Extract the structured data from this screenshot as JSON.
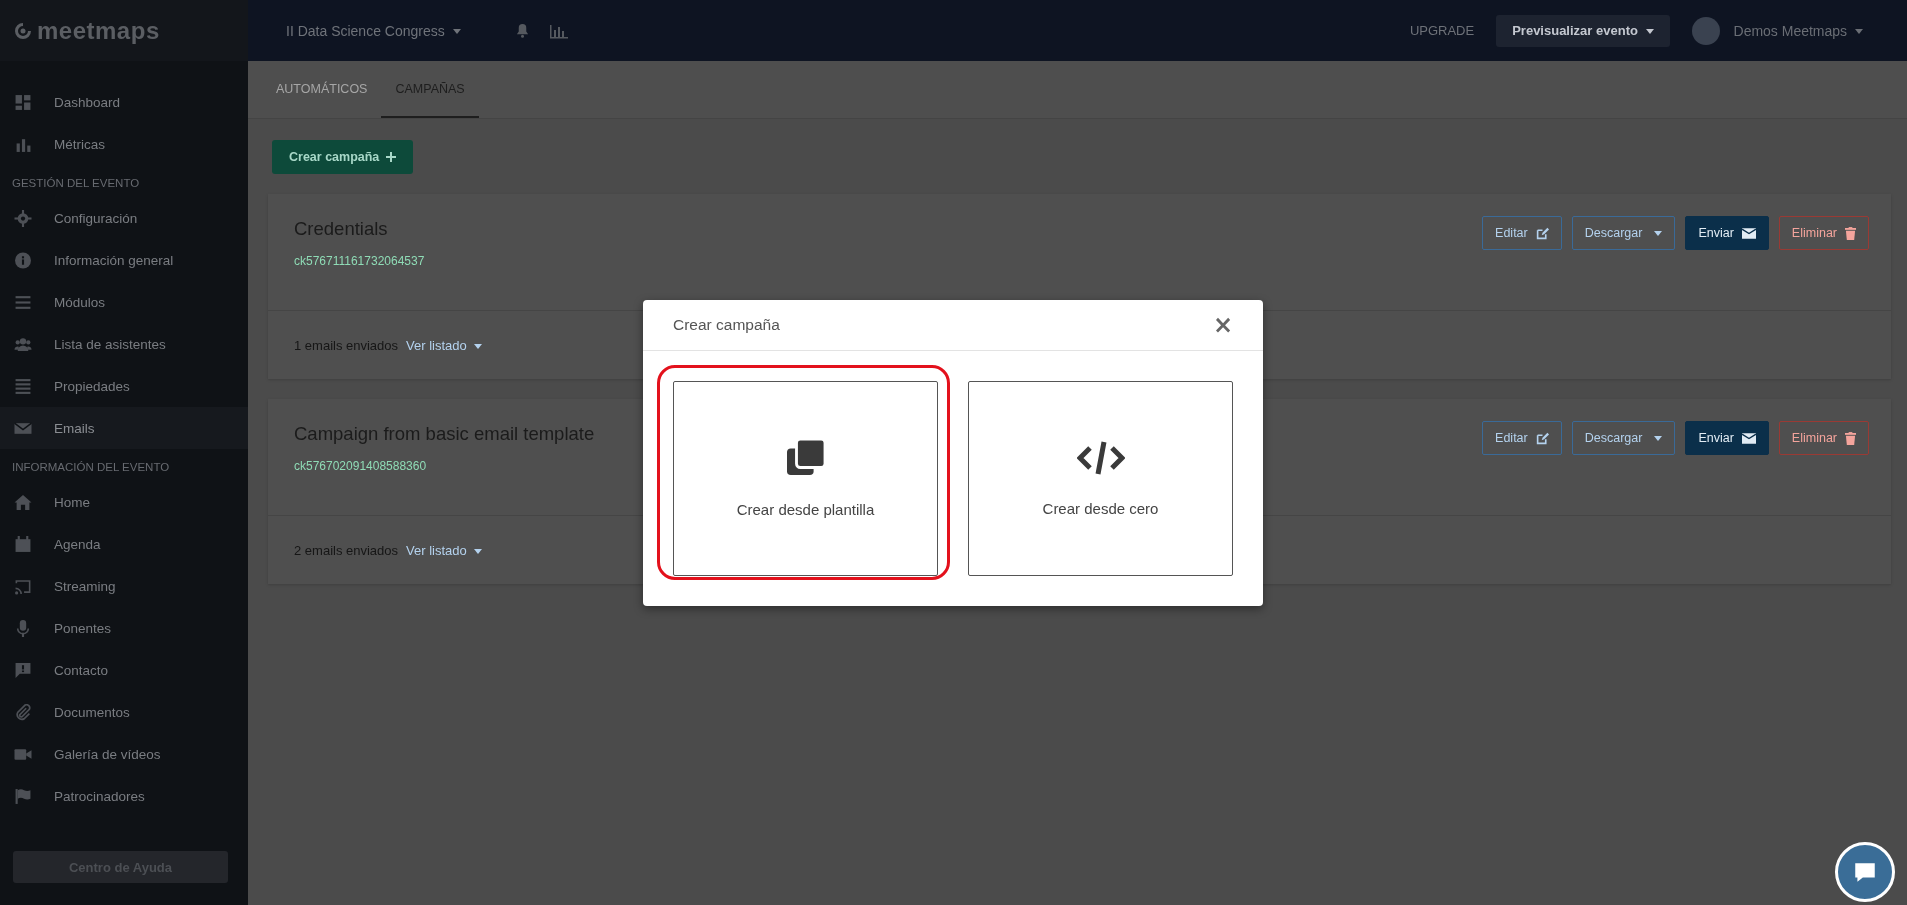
{
  "sidebar": {
    "logo": "meetmaps",
    "nav": [
      {
        "kind": "item",
        "label": "Dashboard",
        "selected": false
      },
      {
        "kind": "item",
        "label": "Métricas",
        "selected": false
      },
      {
        "kind": "section",
        "label": "GESTIÓN DEL EVENTO"
      },
      {
        "kind": "item",
        "label": "Configuración",
        "selected": false
      },
      {
        "kind": "item",
        "label": "Información general",
        "selected": false
      },
      {
        "kind": "item",
        "label": "Módulos",
        "selected": false
      },
      {
        "kind": "item",
        "label": "Lista de asistentes",
        "selected": false
      },
      {
        "kind": "item",
        "label": "Propiedades",
        "selected": false
      },
      {
        "kind": "item",
        "label": "Emails",
        "selected": true
      },
      {
        "kind": "section",
        "label": "INFORMACIÓN DEL EVENTO"
      },
      {
        "kind": "item",
        "label": "Home",
        "selected": false
      },
      {
        "kind": "item",
        "label": "Agenda",
        "selected": false
      },
      {
        "kind": "item",
        "label": "Streaming",
        "selected": false
      },
      {
        "kind": "item",
        "label": "Ponentes",
        "selected": false
      },
      {
        "kind": "item",
        "label": "Contacto",
        "selected": false
      },
      {
        "kind": "item",
        "label": "Documentos",
        "selected": false
      },
      {
        "kind": "item",
        "label": "Galería de vídeos",
        "selected": false
      },
      {
        "kind": "item",
        "label": "Patrocinadores",
        "selected": false
      }
    ],
    "help_button": "Centro de Ayuda"
  },
  "topbar": {
    "event": "II Data Science Congress",
    "upgrade": "UPGRADE",
    "preview": "Previsualizar evento",
    "user": "Demos Meetmaps"
  },
  "tabs": [
    {
      "label": "AUTOMÁTICOS",
      "selected": false
    },
    {
      "label": "CAMPAÑAS",
      "selected": true
    }
  ],
  "create_button": "Crear campaña",
  "campaigns": [
    {
      "title": "Credentials",
      "id": "ck576711161732064537",
      "sent": "1 emails enviados",
      "list_link": "Ver listado",
      "buttons": [
        {
          "kind": "edit",
          "label": "Editar"
        },
        {
          "kind": "download",
          "label": "Descargar"
        },
        {
          "kind": "send",
          "label": "Enviar"
        },
        {
          "kind": "delete",
          "label": "Eliminar"
        }
      ]
    },
    {
      "title": "Campaign from basic email template",
      "id": "ck576702091408588360",
      "sent": "2 emails enviados",
      "list_link": "Ver listado",
      "buttons": [
        {
          "kind": "edit",
          "label": "Editar"
        },
        {
          "kind": "download",
          "label": "Descargar"
        },
        {
          "kind": "send",
          "label": "Enviar"
        },
        {
          "kind": "delete",
          "label": "Eliminar"
        }
      ]
    }
  ],
  "modal": {
    "title": "Crear campaña",
    "close": "×",
    "options": [
      {
        "kind": "template",
        "label": "Crear desde plantilla",
        "highlighted": true
      },
      {
        "kind": "code",
        "label": "Crear desde cero",
        "highlighted": false
      }
    ]
  }
}
